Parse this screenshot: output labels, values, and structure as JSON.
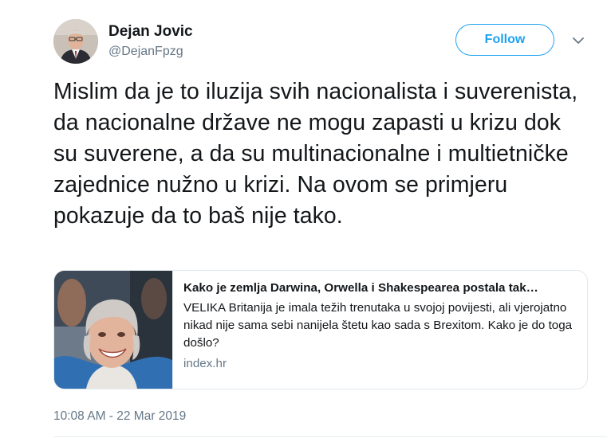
{
  "author": {
    "name": "Dejan Jovic",
    "handle": "@DejanFpzg"
  },
  "follow_label": "Follow",
  "tweet": {
    "text": "Mislim da je to iluzija svih nacionalista i suverenista, da nacionalne države ne mogu zapasti u krizu dok su suverene, a da su multinacionalne i multietničke zajednice nužno u krizi. Na ovom se primjeru pokazuje da to baš nije tako.",
    "timestamp": "10:08 AM - 22 Mar 2019"
  },
  "card": {
    "title": "Kako je zemlja Darwina, Orwella i Shakespearea postala tak…",
    "description": "VELIKA Britanija je imala težih trenutaka u svojoj povijesti, ali vjerojatno nikad nije sama sebi nanijela štetu kao sada s Brexitom. Kako je do toga došlo?",
    "domain": "index.hr"
  },
  "colors": {
    "accent": "#1da1f2",
    "text": "#14171a",
    "secondary": "#657786",
    "border": "#e1e8ed"
  },
  "icons": {
    "more": "chevron-down-icon"
  }
}
